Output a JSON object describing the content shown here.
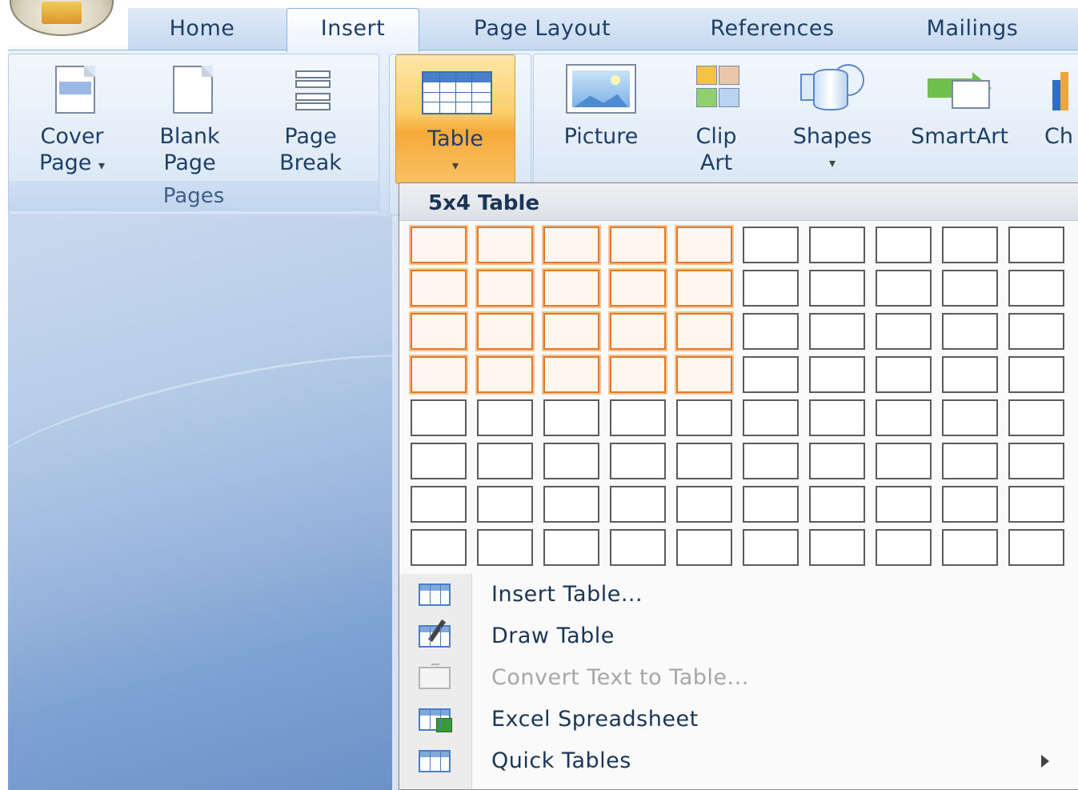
{
  "tabs": [
    {
      "label": "Home"
    },
    {
      "label": "Insert"
    },
    {
      "label": "Page Layout"
    },
    {
      "label": "References"
    },
    {
      "label": "Mailings"
    }
  ],
  "ribbon": {
    "pages_group": {
      "label": "Pages",
      "cover_page": {
        "line1": "Cover",
        "line2": "Page"
      },
      "blank_page": {
        "line1": "Blank",
        "line2": "Page"
      },
      "page_break": {
        "line1": "Page",
        "line2": "Break"
      }
    },
    "table": {
      "label": "Table"
    },
    "picture": {
      "label": "Picture"
    },
    "clip_art": {
      "line1": "Clip",
      "line2": "Art"
    },
    "shapes": {
      "label": "Shapes"
    },
    "smartart": {
      "label": "SmartArt"
    },
    "chart": {
      "label_clipped": "Ch"
    }
  },
  "table_dropdown": {
    "header": "5x4 Table",
    "grid": {
      "columns": 10,
      "rows": 8,
      "selected_columns": 5,
      "selected_rows": 4
    },
    "menu": [
      {
        "icon": "insert-table-icon",
        "label": "Insert Table...",
        "enabled": true
      },
      {
        "icon": "draw-table-icon",
        "label": "Draw Table",
        "enabled": true
      },
      {
        "icon": "convert-text-icon",
        "label": "Convert Text to Table...",
        "enabled": false
      },
      {
        "icon": "excel-spreadsheet-icon",
        "label": "Excel Spreadsheet",
        "enabled": true
      },
      {
        "icon": "quick-tables-icon",
        "label": "Quick Tables",
        "enabled": true,
        "submenu": true
      }
    ]
  },
  "colors": {
    "selection_border": "#e1792a",
    "ribbon_blue": "#dbe7f6",
    "table_button_orange": "#fbcf6a"
  }
}
